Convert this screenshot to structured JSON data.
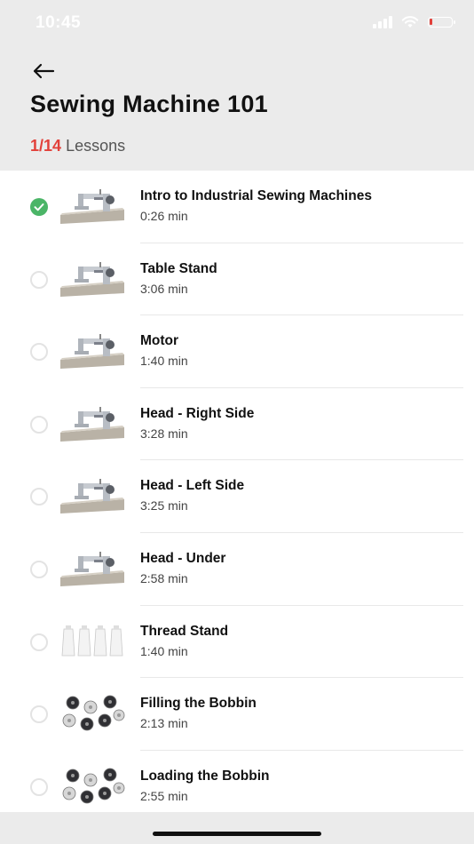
{
  "status_bar": {
    "time": "10:45"
  },
  "header": {
    "title": "Sewing Machine 101",
    "progress_count": "1/14",
    "progress_label": "Lessons"
  },
  "lessons": [
    {
      "title": "Intro to Industrial Sewing Machines",
      "duration": "0:26 min",
      "completed": true,
      "thumb": "sewing-machine"
    },
    {
      "title": "Table Stand",
      "duration": "3:06 min",
      "completed": false,
      "thumb": "sewing-machine"
    },
    {
      "title": "Motor",
      "duration": "1:40 min",
      "completed": false,
      "thumb": "sewing-machine"
    },
    {
      "title": "Head - Right Side",
      "duration": "3:28 min",
      "completed": false,
      "thumb": "sewing-machine"
    },
    {
      "title": "Head - Left Side",
      "duration": "3:25 min",
      "completed": false,
      "thumb": "sewing-machine"
    },
    {
      "title": "Head - Under",
      "duration": "2:58 min",
      "completed": false,
      "thumb": "sewing-machine"
    },
    {
      "title": "Thread Stand",
      "duration": "1:40 min",
      "completed": false,
      "thumb": "thread-spools"
    },
    {
      "title": "Filling the Bobbin",
      "duration": "2:13 min",
      "completed": false,
      "thumb": "bobbins"
    },
    {
      "title": "Loading the Bobbin",
      "duration": "2:55 min",
      "completed": false,
      "thumb": "bobbins"
    }
  ],
  "colors": {
    "accent": "#e2403a",
    "complete": "#4bb567",
    "header_bg": "#ebebeb"
  }
}
